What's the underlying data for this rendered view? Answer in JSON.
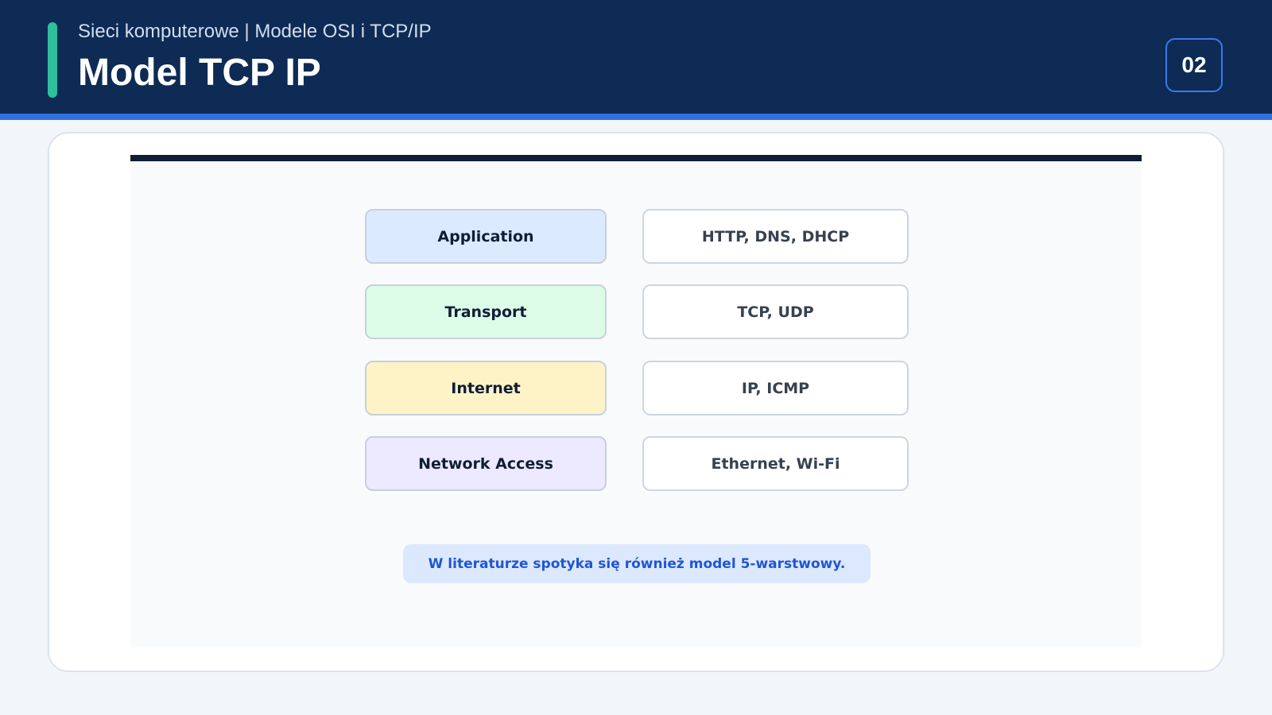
{
  "header": {
    "subtitle": "Sieci komputerowe | Modele OSI i TCP/IP",
    "title": "Model TCP IP",
    "slide_number": "02"
  },
  "colors": {
    "header_bg": "#0d2b55",
    "accent": "#2fbf9c",
    "stripe": "#2f6fe0",
    "note_text": "#1f56d6"
  },
  "diagram": {
    "layers": [
      {
        "name": "Application",
        "protocols": "HTTP, DNS, DHCP",
        "color": "#dbeafe"
      },
      {
        "name": "Transport",
        "protocols": "TCP, UDP",
        "color": "#dcfce7"
      },
      {
        "name": "Internet",
        "protocols": "IP, ICMP",
        "color": "#fef3c7"
      },
      {
        "name": "Network Access",
        "protocols": "Ethernet, Wi-Fi",
        "color": "#ede9fe"
      }
    ],
    "note": "W literaturze spotyka się również model 5-warstwowy."
  }
}
